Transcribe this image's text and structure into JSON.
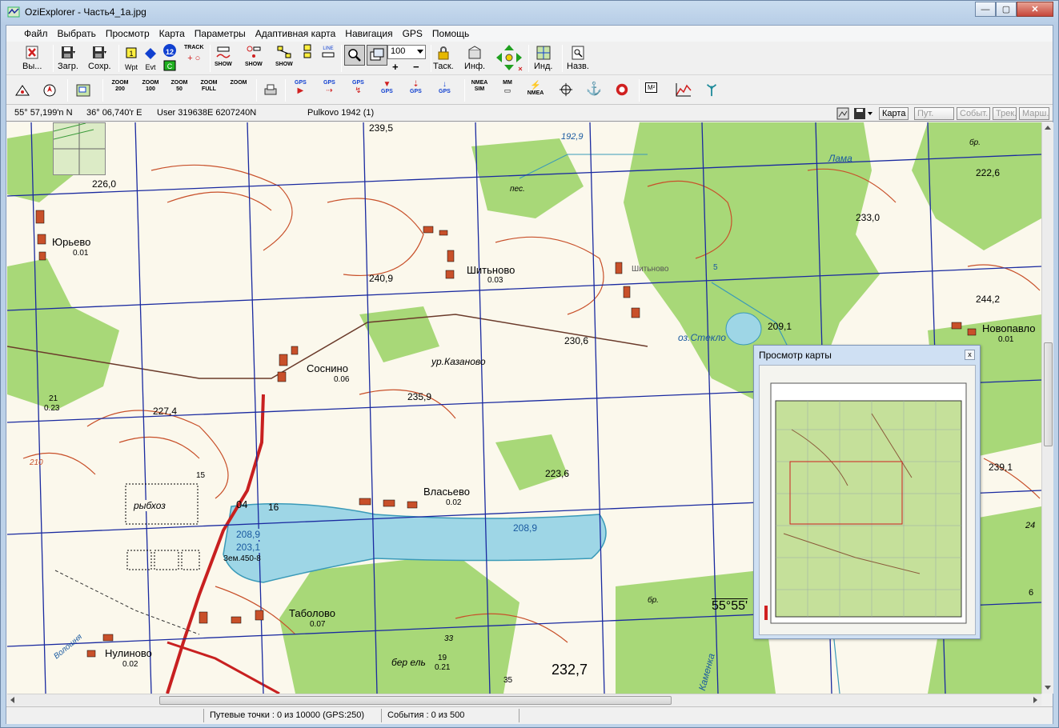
{
  "window": {
    "title": "OziExplorer - Часть4_1а.jpg",
    "minimize": "—",
    "maximize": "▢",
    "close": "✕"
  },
  "menu": {
    "items": [
      "Файл",
      "Выбрать",
      "Просмотр",
      "Карта",
      "Параметры",
      "Адаптивная карта",
      "Навигация",
      "GPS",
      "Помощь"
    ]
  },
  "toolbar1": {
    "exit": "Вы...",
    "load": "Загр.",
    "save": "Сохр.",
    "wpt": "Wpt",
    "evt": "Evt",
    "track_num": "12",
    "track": "TRACK",
    "show": "SHOW",
    "zoom_value": "100",
    "zoom_plus": "+",
    "zoom_minus": "−",
    "task": "Таск.",
    "info": "Инф.",
    "index": "Инд.",
    "name": "Назв."
  },
  "toolbar2": {
    "zoom200": "ZOOM 200",
    "zoom100": "ZOOM 100",
    "zoom50": "ZOOM 50",
    "zoomfull": "ZOOM FULL",
    "zoom": "ZOOM",
    "gps": "GPS",
    "nmea_sim": "NMEA SIM",
    "mm": "MM",
    "nmea": "NMEA",
    "m2": "M²"
  },
  "status_strip": {
    "lat": "55° 57,199'n N",
    "lon": "36° 06,740'r E",
    "user": "User  319638E   6207240N",
    "datum": "Pulkovo 1942 (1)",
    "tab_map": "Карта",
    "tab_wpt": "Пут. точ.",
    "tab_events": "Событ.",
    "tab_tracks": "Трек.",
    "tab_routes": "Марш."
  },
  "map_labels": {
    "yurevo": "Юрьево",
    "yurevo_val": "0.01",
    "shitkovo": "Шитьново",
    "shitkovo_val": "0.03",
    "shitkovo2": "Шитьново",
    "sosnino": "Соснино",
    "sosnino_val": "0.06",
    "kazanovo": "ур.Казаново",
    "vlasevo": "Власьево",
    "vlasevo_val": "0.02",
    "tabolovo": "Таболово",
    "tabolovo_val": "0.07",
    "nulinovo": "Нулиново",
    "nulinovo_val": "0.02",
    "novopavlo": "Новопавло",
    "novopavlo_val": "0.01",
    "rybkhoz": "рыбхоз",
    "zem": "Зем.450-8",
    "lake": "оз.Стекло",
    "lama": "Лама",
    "ber_el": "бер ель",
    "kamenka": "Каменка",
    "voloshnya": "Волошня",
    "h2395": "239,5",
    "h2260": "226,0",
    "h2409": "240,9",
    "h2306": "230,6",
    "h2359": "235,9",
    "h2274": "227,4",
    "h2236": "223,6",
    "h2089a": "208,9",
    "h2031": "203,1",
    "h2089b": "208,9",
    "h2327": "232,7",
    "h2330": "233,0",
    "h2226": "222,6",
    "h2442": "244,2",
    "h2091": "209,1",
    "h2391": "239,1",
    "h1929": "192,9",
    "lat_marker": "55°55'",
    "n04": "04",
    "n16": "16",
    "n210": "210",
    "n21": "21",
    "n023": "0.23",
    "n19": "19",
    "n021": "0.21",
    "n33": "33",
    "n35": "35",
    "n24": "24",
    "n6": "6",
    "n15": "15",
    "n5": "5",
    "br1": "бр.",
    "br2": "бр.",
    "pes": "пес."
  },
  "overview": {
    "title": "Просмотр карты",
    "close": "x"
  },
  "statusbar": {
    "waypoints": "Путевые точки : 0 из 10000  (GPS:250)",
    "events": "События : 0 из 500"
  },
  "colors": {
    "map_bg": "#fbf8ec",
    "forest": "#a8d878",
    "water": "#9ed6e6",
    "contour": "#c8502a",
    "grid": "#1a2aa0",
    "road": "#c82020"
  }
}
